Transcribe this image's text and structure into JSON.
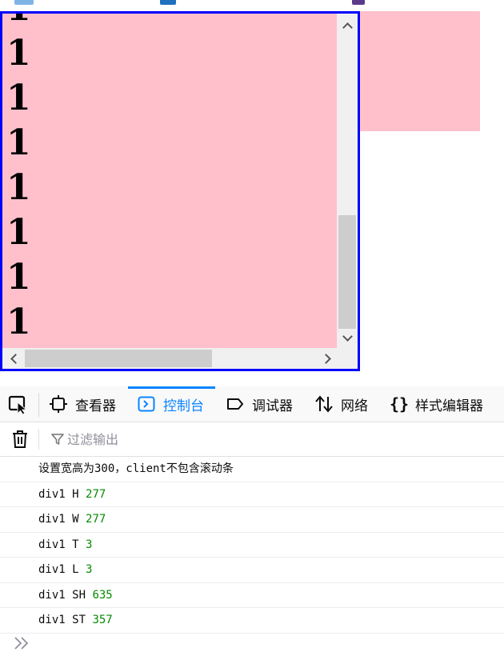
{
  "colors": {
    "demo_bg": "#ffc0cb",
    "demo_border": "#0000ff",
    "accent": "#0a84ff",
    "number_green": "#058b00"
  },
  "demo": {
    "lines": [
      "1",
      "1",
      "1",
      "1",
      "1",
      "1",
      "1",
      "1"
    ],
    "scroll": {
      "vertical_thumb_position_fraction": 0.64,
      "horizontal_thumb_position_fraction": 0.0
    }
  },
  "devtools": {
    "tabs": [
      {
        "label": "查看器",
        "icon": "inspector-icon"
      },
      {
        "label": "控制台",
        "icon": "console-icon",
        "active": true
      },
      {
        "label": "调试器",
        "icon": "debugger-icon"
      },
      {
        "label": "网络",
        "icon": "network-icon"
      },
      {
        "label": "样式编辑器",
        "icon": "style-editor-icon"
      }
    ],
    "toolbar": {
      "trash_icon": "trash-icon",
      "filter_placeholder": "过滤输出"
    },
    "console": {
      "messages": [
        {
          "text": "设置宽高为300，client不包含滚动条"
        },
        {
          "text": "div1 H ",
          "value": "277"
        },
        {
          "text": "div1 W ",
          "value": "277"
        },
        {
          "text": "div1 T ",
          "value": "3"
        },
        {
          "text": "div1 L ",
          "value": "3"
        },
        {
          "text": "div1 SH ",
          "value": "635"
        },
        {
          "text": "div1 ST ",
          "value": "357"
        }
      ],
      "prompt_icon": "chevron-double-right-icon"
    }
  }
}
